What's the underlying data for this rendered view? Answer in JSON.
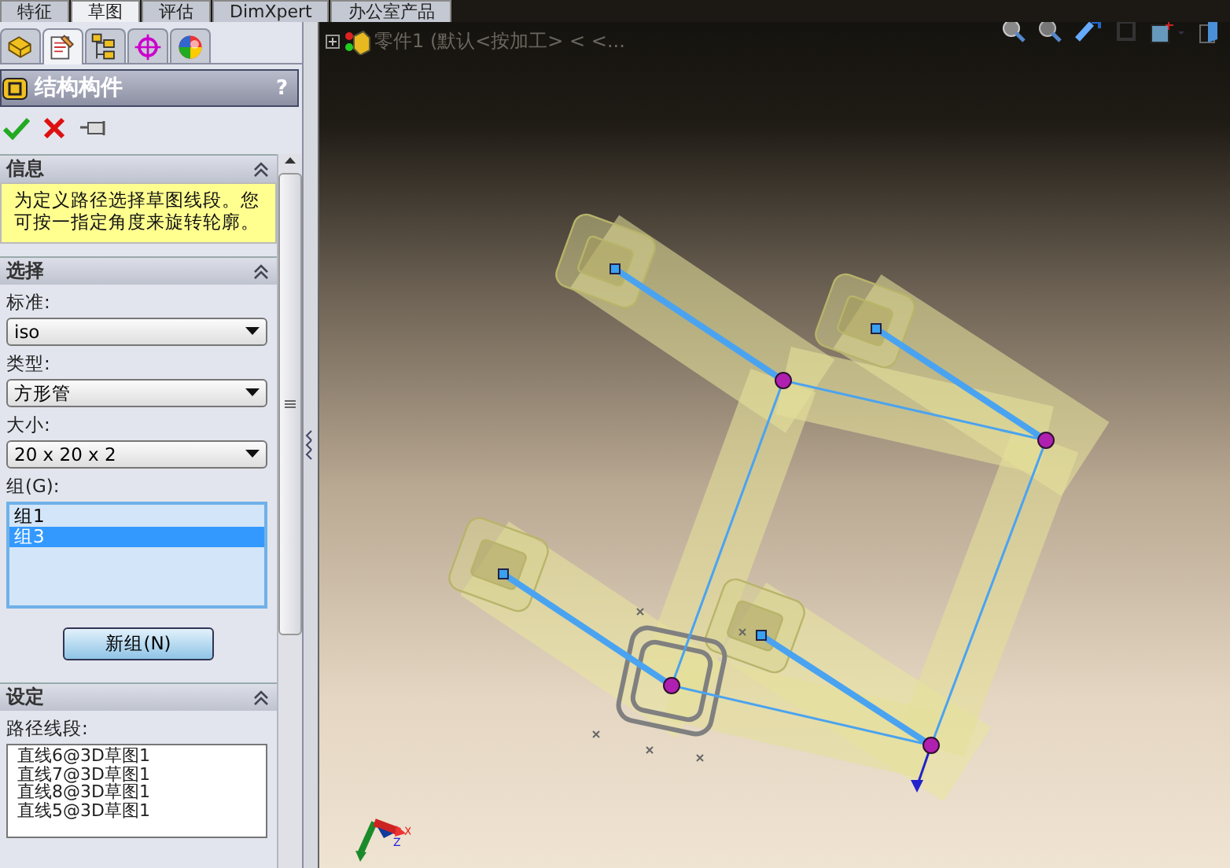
{
  "command_tabs": [
    {
      "label": "特征",
      "selected": false
    },
    {
      "label": "草图",
      "selected": true
    },
    {
      "label": "评估",
      "selected": false
    },
    {
      "label": "DimXpert",
      "selected": false
    },
    {
      "label": "办公室产品",
      "selected": false
    }
  ],
  "manager_tabs": [
    {
      "kind": "feature",
      "selected": false
    },
    {
      "kind": "property",
      "selected": true
    },
    {
      "kind": "config",
      "selected": false
    },
    {
      "kind": "dimxpert",
      "selected": false
    },
    {
      "kind": "display",
      "selected": false
    }
  ],
  "property_manager": {
    "title": "结构构件",
    "help": "?",
    "sections": [
      {
        "kind": "message",
        "title": "信息",
        "text": "为定义路径选择草图线段。您可按一指定角度来旋转轮廓。"
      },
      {
        "kind": "selection",
        "title": "选择",
        "fields": [
          {
            "label": "标准:",
            "value": "iso"
          },
          {
            "label": "类型:",
            "value": "方形管"
          },
          {
            "label": "大小:",
            "value": "20 x 20 x 2"
          }
        ],
        "group_label": "组(G):",
        "groups": [
          {
            "label": "组1",
            "selected": false
          },
          {
            "label": "组3",
            "selected": true
          }
        ],
        "button": "新组(N)"
      },
      {
        "kind": "settings",
        "title": "设定",
        "list_label": "路径线段:",
        "items": [
          "直线6@3D草图1",
          "直线7@3D草图1",
          "直线8@3D草图1",
          "直线5@3D草图1"
        ]
      }
    ]
  },
  "axis_labels": [
    "X",
    "Z"
  ],
  "feature_tree": {
    "root": "零件1 (默认<按加工> < <...",
    "expanded": false
  }
}
